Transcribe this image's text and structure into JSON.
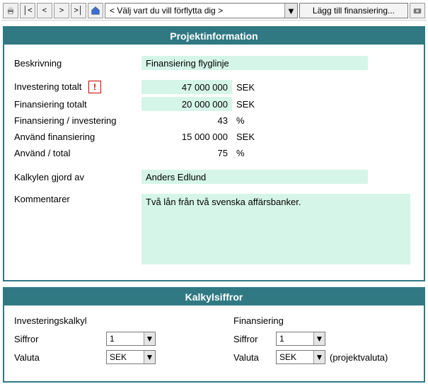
{
  "toolbar": {
    "nav_placeholder": "< Välj vart du vill förflytta dig >",
    "add_financing_label": "Lägg till finansiering..."
  },
  "projektinfo": {
    "header": "Projektinformation",
    "beskrivning_label": "Beskrivning",
    "beskrivning_value": "Finansiering flyglinje",
    "investering_label": "Investering totalt",
    "investering_value": "47 000 000",
    "investering_unit": "SEK",
    "finansiering_label": "Finansiering totalt",
    "finansiering_value": "20 000 000",
    "finansiering_unit": "SEK",
    "fin_inv_label": "Finansiering / investering",
    "fin_inv_value": "43",
    "fin_inv_unit": "%",
    "anvand_fin_label": "Använd finansiering",
    "anvand_fin_value": "15 000 000",
    "anvand_fin_unit": "SEK",
    "anvand_total_label": "Använd / total",
    "anvand_total_value": "75",
    "anvand_total_unit": "%",
    "kalkyl_av_label": "Kalkylen gjord av",
    "kalkyl_av_value": "Anders Edlund",
    "kommentar_label": "Kommentarer",
    "kommentar_value": "Två lån från två svenska affärsbanker."
  },
  "kalkyl": {
    "header": "Kalkylsiffror",
    "left_head": "Investeringskalkyl",
    "right_head": "Finansiering",
    "siffror_label": "Siffror",
    "valuta_label": "Valuta",
    "left_siffror": "1",
    "left_valuta": "SEK",
    "right_siffror": "1",
    "right_valuta": "SEK",
    "projektvaluta": "(projektvaluta)"
  }
}
